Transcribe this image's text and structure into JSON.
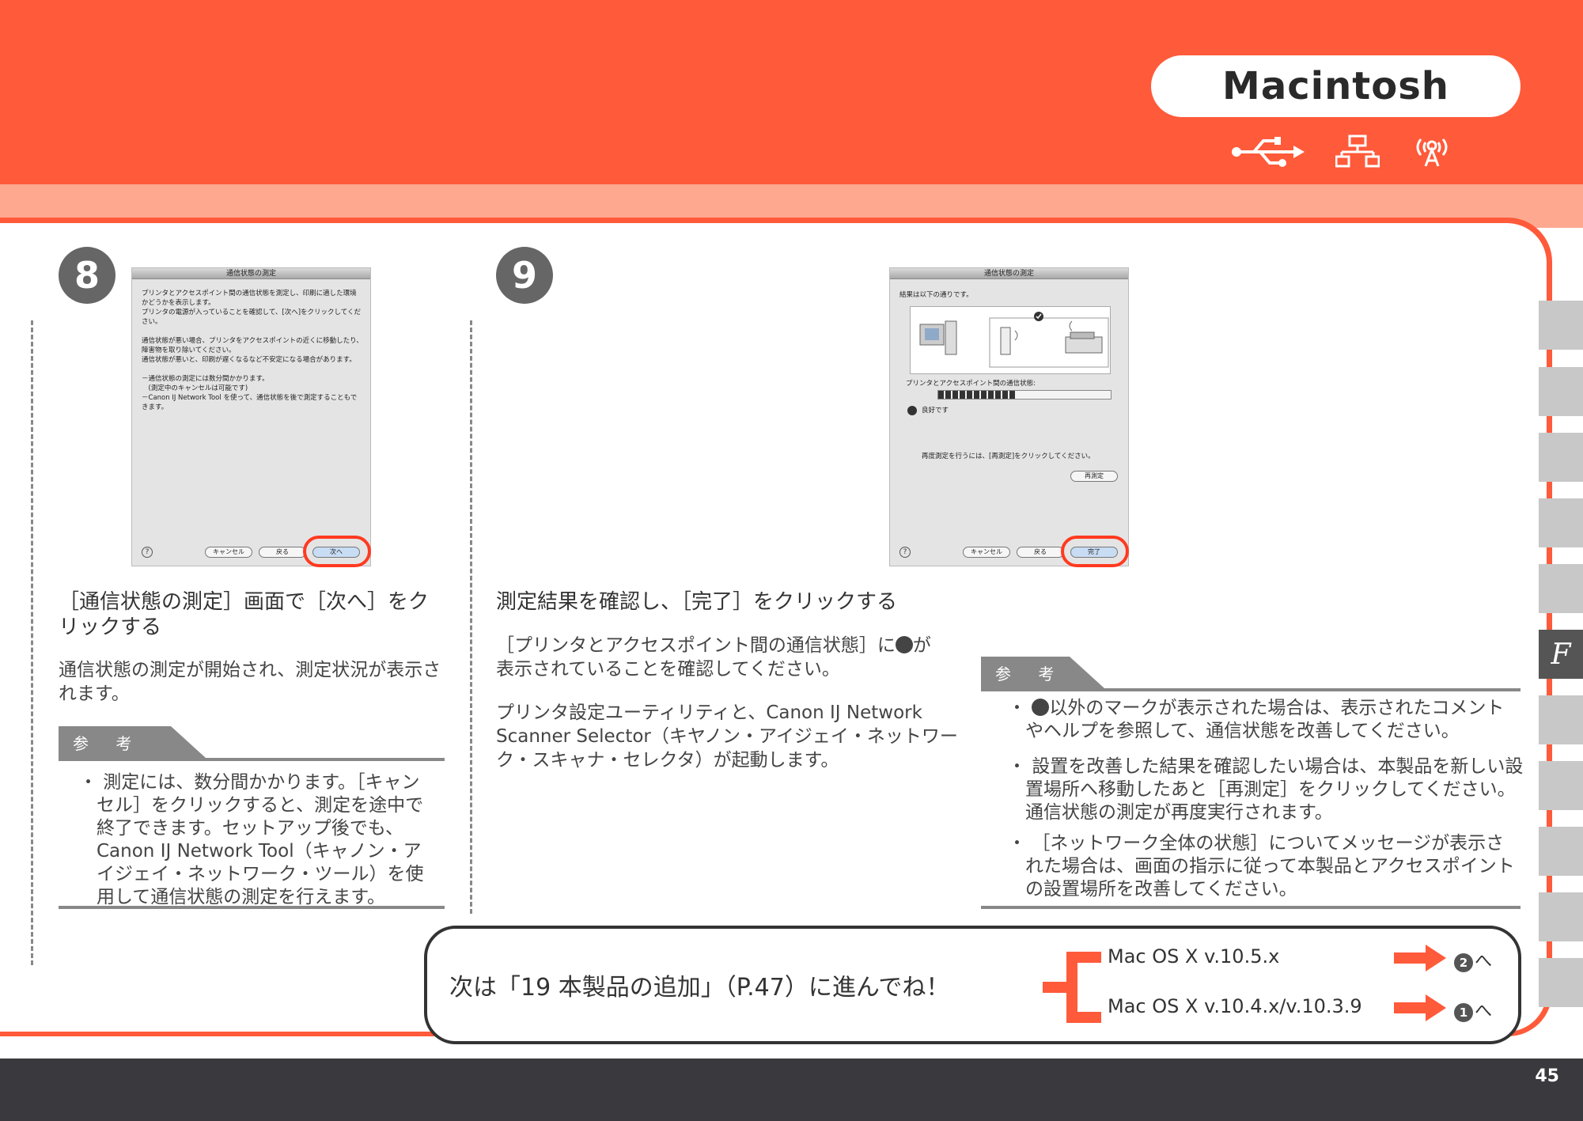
{
  "header": {
    "platform": "Macintosh"
  },
  "connections": [
    {
      "icon": "usb-icon"
    },
    {
      "icon": "wired-lan-icon"
    },
    {
      "icon": "wireless-lan-icon"
    }
  ],
  "side_tab": {
    "active_label": "F"
  },
  "step8": {
    "number": "8",
    "screenshot": {
      "title": "通信状態の測定",
      "text": "プリンタとアクセスポイント間の通信状態を測定し、印刷に適した環境かどうかを表示します。\nプリンタの電源が入っていることを確認して、[次へ]をクリックしてください。\n\n通信状態が悪い場合、プリンタをアクセスポイントの近くに移動したり、障害物を取り除いてください。\n通信状態が悪いと、印刷が遅くなるなど不安定になる場合があります。\n\n－通信状態の測定には数分間かかります。\n　(測定中のキャンセルは可能です)\n－Canon IJ Network Tool を使って、通信状態を後で測定することもできます。",
      "help": "?",
      "cancel": "キャンセル",
      "back": "戻る",
      "next": "次へ"
    },
    "heading": "［通信状態の測定］画面で［次へ］をクリックする",
    "body": "通信状態の測定が開始され、測定状況が表示されます。",
    "note_label": "参 考",
    "notes": [
      "・ 測定には、数分間かかります。［キャンセル］をクリックすると、測定を途中で終了できます。セットアップ後でも、Canon IJ Network Tool（キャノン・アイジェイ・ネットワーク・ツール）を使用して通信状態の測定を行えます。"
    ]
  },
  "step9": {
    "number": "9",
    "screenshot": {
      "title": "通信状態の測定",
      "result_intro": "結果は以下の通りです。",
      "status_label": "プリンタとアクセスポイント間の通信状態:",
      "status_value": "良好です",
      "signal_level": 0.45,
      "remeasure_text": "再度測定を行うには、[再測定]をクリックしてください。",
      "remeasure": "再測定",
      "help": "?",
      "cancel": "キャンセル",
      "back": "戻る",
      "finish": "完了"
    },
    "heading": "測定結果を確認し、［完了］をクリックする",
    "body1_a": "［プリンタとアクセスポイント間の通信状態］に",
    "body1_b": "が表示されていることを確認してください。",
    "body2": "プリンタ設定ユーティリティと、Canon IJ Network Scanner Selector（キヤノン・アイジェイ・ネットワーク・スキャナ・セレクタ）が起動します。",
    "note_label": "参 考",
    "notes": [
      "以外のマークが表示された場合は、表示されたコメントやヘルプを参照して、通信状態を改善してください。",
      "設置を改善した結果を確認したい場合は、本製品を新しい設置場所へ移動したあと［再測定］をクリックしてください。通信状態の測定が再度実行されます。",
      "［ネットワーク全体の状態］についてメッセージが表示された場合は、画面の指示に従って本製品とアクセスポイントの設置場所を改善してください。"
    ]
  },
  "next": {
    "text": "次は「19 本製品の追加」（P.47）に進んでね！",
    "options": [
      {
        "os": "Mac OS X v.10.5.x",
        "num": "2",
        "suffix": "へ"
      },
      {
        "os": "Mac OS X v.10.4.x/v.10.3.9",
        "num": "1",
        "suffix": "へ"
      }
    ]
  },
  "footer": {
    "page": "45"
  },
  "colors": {
    "accent": "#ff5a3a",
    "salmon": "#ffa890",
    "dark": "#3a3a3e",
    "gray": "#888888"
  }
}
